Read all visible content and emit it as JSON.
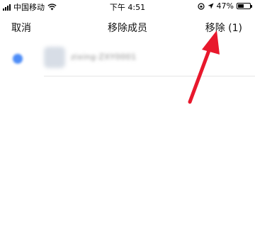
{
  "status_bar": {
    "carrier": "中国移动",
    "time": "下午 4:51",
    "battery_percent": "47%",
    "battery_level": 0.47
  },
  "nav": {
    "cancel_label": "取消",
    "title": "移除成员",
    "remove_label": "移除 (1)"
  },
  "members": [
    {
      "name": "zixing·ZXY0001",
      "selected": true
    }
  ],
  "colors": {
    "checkbox": "#4d8cf7",
    "arrow": "#e8182c"
  },
  "icons": [
    "signal-icon",
    "wifi-icon",
    "orientation-lock-icon",
    "location-icon",
    "battery-icon",
    "checkbox-icon",
    "avatar",
    "arrow-annotation"
  ]
}
